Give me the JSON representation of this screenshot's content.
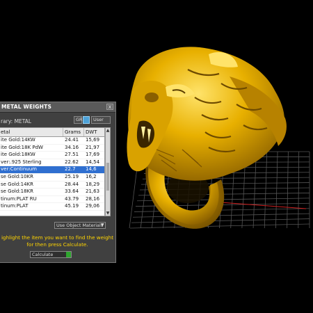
{
  "dialog": {
    "title": "METAL WEIGHTS",
    "close": "x",
    "library_label": "rary: METAL",
    "units": [
      "GR",
      "",
      "User"
    ],
    "table": {
      "columns": [
        "etal",
        "Grams",
        "DWT"
      ],
      "rows": [
        [
          "ite Gold:14KW",
          "24.41",
          "15,69"
        ],
        [
          "ite Gold:18K PdW",
          "34.16",
          "21,97"
        ],
        [
          "ite Gold:18KW",
          "27.51",
          "17,69"
        ],
        [
          "ver:.925 Sterling",
          "22.62",
          "14,54"
        ],
        [
          "ver:Continuum",
          "22.7",
          "14,6"
        ],
        [
          "se Gold:10KR",
          "25.19",
          "16,2"
        ],
        [
          "se Gold:14KR",
          "28.44",
          "18,29"
        ],
        [
          "se Gold:18KR",
          "33.64",
          "21,63"
        ],
        [
          "tinum:PLAT RU",
          "43.79",
          "28,16"
        ],
        [
          "tinum:PLAT",
          "45.19",
          "29,06"
        ]
      ],
      "selected_row": 4
    },
    "use_materials": "Use Object Materials",
    "instructions": "ighlight the item you want to find the weight for then press Calculate.",
    "calculate": "Calculate"
  },
  "colors": {
    "gold_base": "#c99400",
    "gold_highlight": "#ffe36a",
    "grid_line": "#555",
    "grid_axis_red": "#d02020",
    "grid_axis_green": "#209020",
    "instruction_yellow": "#ffd400",
    "selection": "#2f6fd0"
  }
}
